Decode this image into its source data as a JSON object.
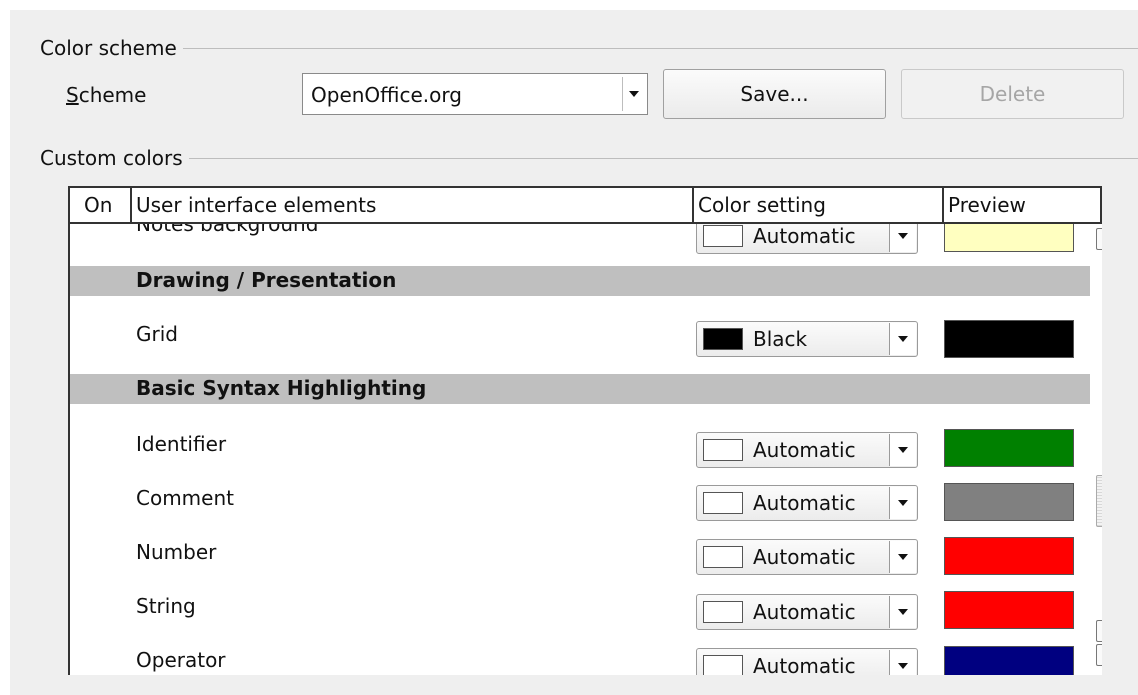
{
  "color_scheme": {
    "group_title": "Color scheme",
    "scheme_label": "Scheme",
    "scheme_value": "OpenOffice.org",
    "save_button": "Save...",
    "delete_button": "Delete"
  },
  "custom_colors": {
    "group_title": "Custom colors",
    "columns": [
      "On",
      "User interface elements",
      "Color setting",
      "Preview"
    ],
    "rows": [
      {
        "label": "Notes background",
        "setting": "Automatic",
        "swatch": "#ffffff",
        "preview": "#ffffc0"
      },
      {
        "section": "Drawing / Presentation"
      },
      {
        "label": "Grid",
        "setting": "Black",
        "swatch": "#000000",
        "preview": "#000000"
      },
      {
        "section": "Basic Syntax Highlighting"
      },
      {
        "label": "Identifier",
        "setting": "Automatic",
        "swatch": "#ffffff",
        "preview": "#008000"
      },
      {
        "label": "Comment",
        "setting": "Automatic",
        "swatch": "#ffffff",
        "preview": "#808080"
      },
      {
        "label": "Number",
        "setting": "Automatic",
        "swatch": "#ffffff",
        "preview": "#ff0000"
      },
      {
        "label": "String",
        "setting": "Automatic",
        "swatch": "#ffffff",
        "preview": "#ff0000"
      },
      {
        "label": "Operator",
        "setting": "Automatic",
        "swatch": "#ffffff",
        "preview": "#000080"
      }
    ]
  }
}
